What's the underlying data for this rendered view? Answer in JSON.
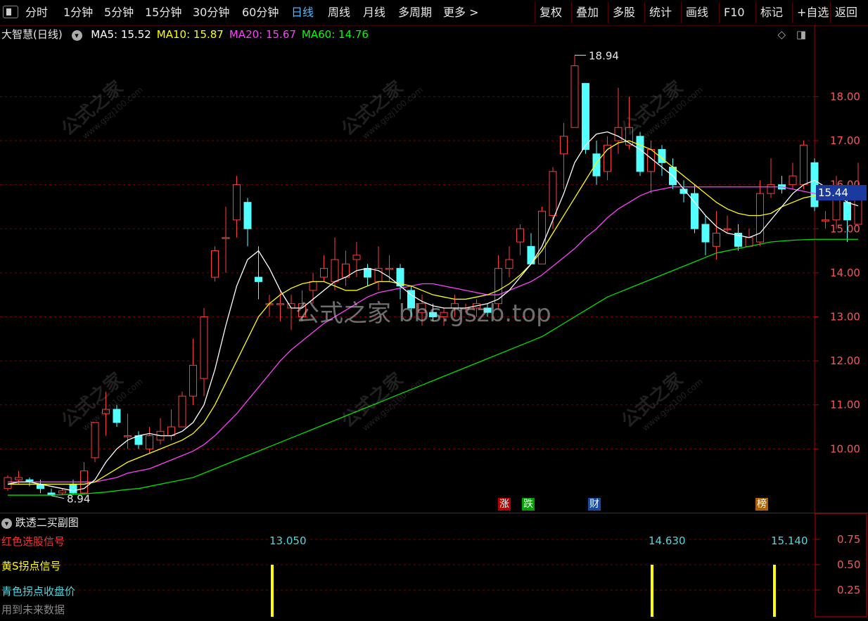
{
  "toolbar": {
    "periods": [
      "分时",
      "1分钟",
      "5分钟",
      "15分钟",
      "30分钟",
      "60分钟",
      "日线",
      "周线",
      "月线",
      "多周期",
      "更多 >"
    ],
    "active_period": "日线",
    "actions": [
      "复权",
      "叠加",
      "多股",
      "统计",
      "画线",
      "F10",
      "标记",
      "+自选",
      "返回"
    ]
  },
  "main_chart": {
    "stock_name": "大智慧(日线)",
    "ma": [
      {
        "label": "MA5: 15.52",
        "color": "#ffffff"
      },
      {
        "label": "MA10: 15.87",
        "color": "#ffff00"
      },
      {
        "label": "MA20: 15.67",
        "color": "#ff40ff"
      },
      {
        "label": "MA60: 14.76",
        "color": "#00ff00"
      }
    ],
    "high_mark": "18.94",
    "low_mark": "8.94",
    "last_price": "15.44",
    "watermark_center": "公式之家 bbs.gszb.top",
    "watermark_tile": "公式之家",
    "watermark_tile_url": "www.gszj100.com",
    "badges": [
      {
        "text": "涨",
        "color": "#b00000"
      },
      {
        "text": "跌",
        "color": "#00a000"
      },
      {
        "text": "财",
        "color": "#1a4aa0"
      },
      {
        "text": "榜",
        "color": "#b06000"
      }
    ]
  },
  "sub_chart": {
    "title": "跌透二买副图",
    "lines": [
      {
        "label": "红色选股信号",
        "color": "#ff3030"
      },
      {
        "label": "黄S拐点信号",
        "color": "#ffff00"
      },
      {
        "label": "青色拐点收盘价",
        "color": "#4fd7e0"
      },
      {
        "label": "用到未来数据",
        "color": "#888888"
      }
    ],
    "signal_values": [
      "13.050",
      "14.630",
      "15.140"
    ],
    "y_ticks": [
      "0.75",
      "0.50",
      "0.25"
    ]
  },
  "chart_data": {
    "type": "candlestick",
    "y_ticks": [
      "18.00",
      "17.00",
      "16.00",
      "15.00",
      "14.00",
      "13.00",
      "12.00",
      "11.00",
      "10.00"
    ],
    "ylim": [
      8.6,
      19.3
    ],
    "candles": [
      [
        9.1,
        9.35,
        9.4,
        9.05
      ],
      [
        9.3,
        9.35,
        9.5,
        9.2
      ],
      [
        9.3,
        9.25,
        9.35,
        9.15
      ],
      [
        9.2,
        9.1,
        9.3,
        9.0
      ],
      [
        9.0,
        8.95,
        9.1,
        8.94
      ],
      [
        9.0,
        9.05,
        9.1,
        8.95
      ],
      [
        9.2,
        9.0,
        9.3,
        8.95
      ],
      [
        9.0,
        9.5,
        9.7,
        9.0
      ],
      [
        9.8,
        10.6,
        10.6,
        9.7
      ],
      [
        10.8,
        10.9,
        11.3,
        10.3
      ],
      [
        10.9,
        10.6,
        11.0,
        10.5
      ],
      [
        10.3,
        10.3,
        10.8,
        10.0
      ],
      [
        10.3,
        10.1,
        10.4,
        10.0
      ],
      [
        10.0,
        10.3,
        10.5,
        9.9
      ],
      [
        10.2,
        10.4,
        10.7,
        10.1
      ],
      [
        10.3,
        10.5,
        10.9,
        10.2
      ],
      [
        10.5,
        11.2,
        11.3,
        10.5
      ],
      [
        11.2,
        11.9,
        12.5,
        11.0
      ],
      [
        11.6,
        13.0,
        13.2,
        11.2
      ],
      [
        13.9,
        14.5,
        14.6,
        13.8
      ],
      [
        14.8,
        14.8,
        15.5,
        14.0
      ],
      [
        15.2,
        16.0,
        16.2,
        14.8
      ],
      [
        15.6,
        15.0,
        15.7,
        14.6
      ],
      [
        13.9,
        13.8,
        14.6,
        13.4
      ],
      [
        13.3,
        13.3,
        13.5,
        13.0
      ],
      [
        13.3,
        13.3,
        13.6,
        12.9
      ],
      [
        13.2,
        13.3,
        13.5,
        12.7
      ],
      [
        13.0,
        13.3,
        13.6,
        12.9
      ],
      [
        13.6,
        13.8,
        14.0,
        13.3
      ],
      [
        13.9,
        14.1,
        14.4,
        13.8
      ],
      [
        13.8,
        14.3,
        14.8,
        13.6
      ],
      [
        13.9,
        14.2,
        14.5,
        13.7
      ],
      [
        14.3,
        14.4,
        14.7,
        13.9
      ],
      [
        14.1,
        13.9,
        14.2,
        13.7
      ],
      [
        13.8,
        14.1,
        14.6,
        13.6
      ],
      [
        14.1,
        14.1,
        14.4,
        13.8
      ],
      [
        14.1,
        13.7,
        14.2,
        13.4
      ],
      [
        13.6,
        13.2,
        13.7,
        13.0
      ],
      [
        13.1,
        13.3,
        13.5,
        12.8
      ],
      [
        13.1,
        13.0,
        13.3,
        12.9
      ],
      [
        13.0,
        13.1,
        13.2,
        12.8
      ],
      [
        13.2,
        13.3,
        13.5,
        13.0
      ],
      [
        13.2,
        13.2,
        13.3,
        13.1
      ],
      [
        13.2,
        13.3,
        13.4,
        13.0
      ],
      [
        13.2,
        13.1,
        13.3,
        13.0
      ],
      [
        13.3,
        14.1,
        14.4,
        13.2
      ],
      [
        14.1,
        14.3,
        14.6,
        13.9
      ],
      [
        14.7,
        15.0,
        15.1,
        14.4
      ],
      [
        14.6,
        14.2,
        14.9,
        14.2
      ],
      [
        14.2,
        15.4,
        15.5,
        14.2
      ],
      [
        15.3,
        16.3,
        16.4,
        15.0
      ],
      [
        16.7,
        17.1,
        17.4,
        15.9
      ],
      [
        17.3,
        18.7,
        18.94,
        17.3
      ],
      [
        18.3,
        16.8,
        18.3,
        16.7
      ],
      [
        16.7,
        16.2,
        17.0,
        16.0
      ],
      [
        16.3,
        16.9,
        17.1,
        16.1
      ],
      [
        17.0,
        17.3,
        18.2,
        16.7
      ],
      [
        16.9,
        17.3,
        18.0,
        16.8
      ],
      [
        17.1,
        16.3,
        17.2,
        16.2
      ],
      [
        16.3,
        16.8,
        17.0,
        15.8
      ],
      [
        16.8,
        16.5,
        16.9,
        16.2
      ],
      [
        16.4,
        16.0,
        16.6,
        15.9
      ],
      [
        15.9,
        15.8,
        16.1,
        15.6
      ],
      [
        15.8,
        15.0,
        16.0,
        14.9
      ],
      [
        15.1,
        14.7,
        15.3,
        14.4
      ],
      [
        14.6,
        14.9,
        15.4,
        14.3
      ],
      [
        15.0,
        15.0,
        15.3,
        14.9
      ],
      [
        14.9,
        14.6,
        15.1,
        14.5
      ],
      [
        14.6,
        14.8,
        15.0,
        14.6
      ],
      [
        14.7,
        15.8,
        16.1,
        14.6
      ],
      [
        15.8,
        16.0,
        16.6,
        15.7
      ],
      [
        16.0,
        15.9,
        16.2,
        15.8
      ],
      [
        16.0,
        16.2,
        16.5,
        15.9
      ],
      [
        16.0,
        16.9,
        17.0,
        15.9
      ],
      [
        16.5,
        15.5,
        16.6,
        15.4
      ],
      [
        15.2,
        15.2,
        15.4,
        15.0
      ],
      [
        15.2,
        15.8,
        16.2,
        15.0
      ],
      [
        15.6,
        15.2,
        15.8,
        14.7
      ],
      [
        15.1,
        15.9,
        16.5,
        15.1
      ]
    ],
    "ma5": [
      9.2,
      9.25,
      9.25,
      9.2,
      9.15,
      9.1,
      9.05,
      9.1,
      9.3,
      9.7,
      10.0,
      10.2,
      10.3,
      10.35,
      10.3,
      10.3,
      10.4,
      10.6,
      11.0,
      11.8,
      12.8,
      13.7,
      14.3,
      14.5,
      14.1,
      13.6,
      13.2,
      13.2,
      13.4,
      13.6,
      13.8,
      13.9,
      14.05,
      14.1,
      14.05,
      13.9,
      13.7,
      13.5,
      13.35,
      13.25,
      13.2,
      13.2,
      13.2,
      13.25,
      13.3,
      13.4,
      13.6,
      13.9,
      14.2,
      14.6,
      15.2,
      15.8,
      16.5,
      16.9,
      17.15,
      17.2,
      17.1,
      16.95,
      16.8,
      16.6,
      16.4,
      16.2,
      15.9,
      15.6,
      15.3,
      15.05,
      14.9,
      14.85,
      14.8,
      14.9,
      15.2,
      15.5,
      15.8,
      16.0,
      16.1,
      15.95,
      15.8,
      15.6,
      15.52
    ],
    "ma10": [
      9.2,
      9.2,
      9.2,
      9.2,
      9.2,
      9.2,
      9.2,
      9.2,
      9.25,
      9.4,
      9.55,
      9.7,
      9.8,
      9.9,
      10.0,
      10.1,
      10.2,
      10.35,
      10.6,
      11.0,
      11.5,
      12.0,
      12.5,
      13.0,
      13.3,
      13.5,
      13.65,
      13.75,
      13.8,
      13.8,
      13.7,
      13.6,
      13.6,
      13.7,
      13.8,
      13.8,
      13.75,
      13.7,
      13.6,
      13.5,
      13.45,
      13.4,
      13.4,
      13.45,
      13.5,
      13.6,
      13.75,
      13.95,
      14.2,
      14.5,
      14.9,
      15.3,
      15.7,
      16.1,
      16.5,
      16.8,
      16.95,
      17.0,
      16.9,
      16.8,
      16.6,
      16.4,
      16.2,
      16.0,
      15.8,
      15.6,
      15.45,
      15.35,
      15.3,
      15.3,
      15.35,
      15.5,
      15.6,
      15.7,
      15.75,
      15.8,
      15.85,
      15.86,
      15.87
    ],
    "ma20": [
      9.25,
      9.25,
      9.25,
      9.25,
      9.25,
      9.25,
      9.25,
      9.25,
      9.25,
      9.3,
      9.35,
      9.45,
      9.5,
      9.55,
      9.65,
      9.75,
      9.85,
      9.95,
      10.1,
      10.3,
      10.55,
      10.8,
      11.1,
      11.4,
      11.7,
      12.0,
      12.25,
      12.45,
      12.65,
      12.85,
      13.0,
      13.15,
      13.3,
      13.45,
      13.55,
      13.6,
      13.65,
      13.7,
      13.75,
      13.75,
      13.7,
      13.65,
      13.6,
      13.55,
      13.5,
      13.5,
      13.6,
      13.7,
      13.8,
      13.95,
      14.15,
      14.35,
      14.55,
      14.8,
      15.0,
      15.25,
      15.45,
      15.6,
      15.75,
      15.85,
      15.9,
      15.95,
      15.95,
      15.95,
      15.95,
      15.95,
      15.95,
      15.95,
      15.95,
      15.95,
      15.95,
      15.95,
      15.9,
      15.85,
      15.8,
      15.75,
      15.7,
      15.68,
      15.67
    ],
    "ma60": [
      8.95,
      8.95,
      8.95,
      8.95,
      8.95,
      8.96,
      8.97,
      8.98,
      9.0,
      9.02,
      9.05,
      9.08,
      9.1,
      9.15,
      9.2,
      9.25,
      9.3,
      9.35,
      9.45,
      9.55,
      9.65,
      9.75,
      9.85,
      9.95,
      10.05,
      10.15,
      10.25,
      10.35,
      10.45,
      10.55,
      10.65,
      10.75,
      10.85,
      10.95,
      11.05,
      11.15,
      11.25,
      11.35,
      11.45,
      11.55,
      11.65,
      11.75,
      11.85,
      11.95,
      12.05,
      12.15,
      12.25,
      12.35,
      12.45,
      12.55,
      12.7,
      12.85,
      13.0,
      13.15,
      13.3,
      13.45,
      13.55,
      13.65,
      13.75,
      13.85,
      13.95,
      14.05,
      14.15,
      14.25,
      14.35,
      14.45,
      14.5,
      14.55,
      14.6,
      14.65,
      14.7,
      14.72,
      14.74,
      14.75,
      14.76,
      14.76,
      14.76,
      14.76,
      14.76
    ]
  }
}
